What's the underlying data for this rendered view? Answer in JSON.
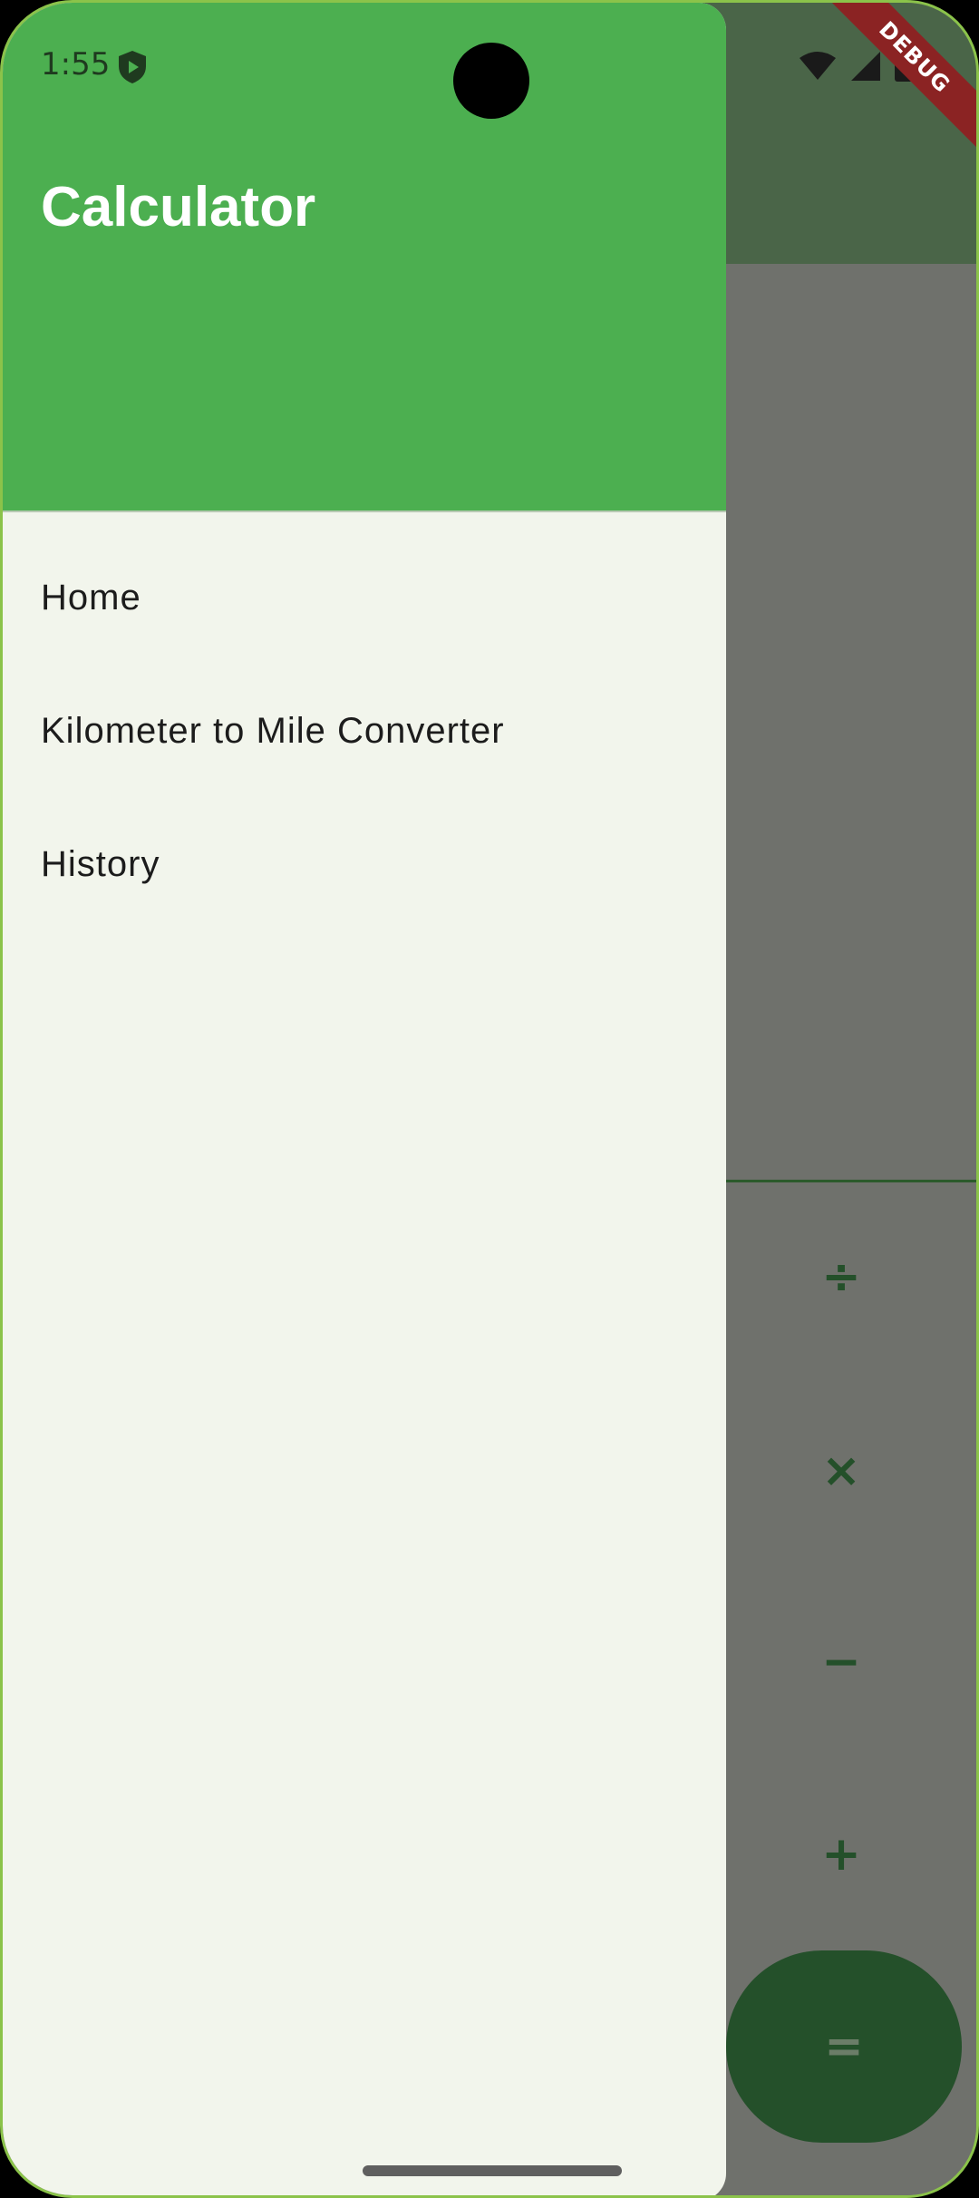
{
  "status_bar": {
    "time": "1:55"
  },
  "debug_banner": "DEBUG",
  "drawer": {
    "title": "Calculator",
    "items": [
      {
        "label": "Home"
      },
      {
        "label": "Kilometer to Mile Converter"
      },
      {
        "label": "History"
      }
    ]
  },
  "calculator": {
    "operators": [
      "÷",
      "×",
      "−",
      "+"
    ],
    "equals": "="
  },
  "colors": {
    "header_green": "#4caf50",
    "drawer_bg": "#f2f5ec",
    "scrim_gray": "#6f716c",
    "button_dark_green": "#24502a"
  }
}
